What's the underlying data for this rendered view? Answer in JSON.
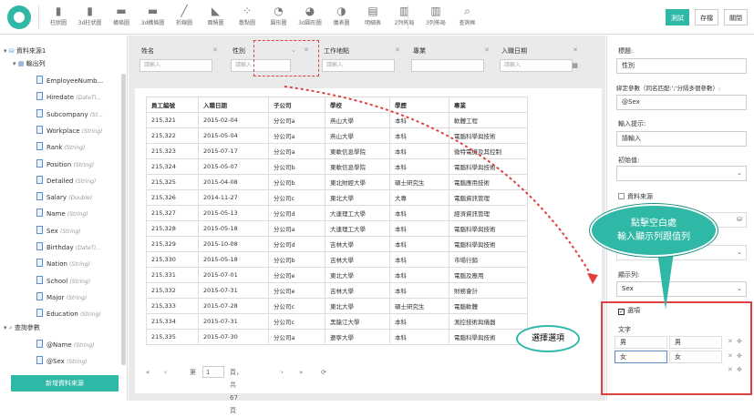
{
  "toolbar": {
    "items": [
      {
        "label": "柱狀圖",
        "icon": "bar-chart-icon"
      },
      {
        "label": "3d柱狀圖",
        "icon": "bar3d-chart-icon"
      },
      {
        "label": "橫條圖",
        "icon": "hbar-chart-icon"
      },
      {
        "label": "3d橫條圖",
        "icon": "hbar3d-chart-icon"
      },
      {
        "label": "折線圖",
        "icon": "line-chart-icon"
      },
      {
        "label": "面積圖",
        "icon": "area-chart-icon"
      },
      {
        "label": "散點圖",
        "icon": "scatter-chart-icon"
      },
      {
        "label": "圓形圖",
        "icon": "pie-chart-icon"
      },
      {
        "label": "3d圓形圖",
        "icon": "pie3d-chart-icon"
      },
      {
        "label": "儀表圖",
        "icon": "gauge-chart-icon"
      },
      {
        "label": "明細表",
        "icon": "detail-table-icon"
      },
      {
        "label": "2列佈局",
        "icon": "two-column-layout-icon"
      },
      {
        "label": "3列佈局",
        "icon": "three-column-layout-icon"
      },
      {
        "label": "查詢框",
        "icon": "query-box-icon"
      }
    ],
    "test_label": "測試",
    "save_label": "存檔",
    "close_label": "關閉"
  },
  "sidebar": {
    "datasource": "資料來源1",
    "output_columns": "輸出列",
    "fields": [
      {
        "name": "EmployeeNumb...",
        "type": ""
      },
      {
        "name": "Hiredate",
        "type": "(DateTi..."
      },
      {
        "name": "Subcompany",
        "type": "(St..."
      },
      {
        "name": "Workplace",
        "type": "(String)"
      },
      {
        "name": "Rank",
        "type": "(String)"
      },
      {
        "name": "Position",
        "type": "(String)"
      },
      {
        "name": "Detailed",
        "type": "(String)"
      },
      {
        "name": "Salary",
        "type": "(Double)"
      },
      {
        "name": "Name",
        "type": "(String)"
      },
      {
        "name": "Sex",
        "type": "(String)"
      },
      {
        "name": "Birthday",
        "type": "(DateTi..."
      },
      {
        "name": "Nation",
        "type": "(String)"
      },
      {
        "name": "School",
        "type": "(String)"
      },
      {
        "name": "Major",
        "type": "(String)"
      },
      {
        "name": "Education",
        "type": "(String)"
      }
    ],
    "query_params": "查詢參數",
    "params": [
      {
        "name": "@Name",
        "type": "(String)"
      },
      {
        "name": "@Sex",
        "type": "(String)"
      }
    ],
    "add_source": "新增資料來源"
  },
  "filters": [
    {
      "label": "姓名",
      "placeholder": "請輸入"
    },
    {
      "label": "性別",
      "placeholder": "請輸入"
    },
    {
      "label": "工作地點",
      "placeholder": "請輸入"
    },
    {
      "label": "專業",
      "placeholder": ""
    },
    {
      "label": "入職日期",
      "placeholder": "請輸入"
    }
  ],
  "table": {
    "headers": [
      "員工編號",
      "入職日期",
      "子公司",
      "學校",
      "學歷",
      "專業"
    ],
    "rows": [
      [
        "215,321",
        "2015-02-04",
        "分公司a",
        "燕山大學",
        "本科",
        "軟體工程"
      ],
      [
        "215,322",
        "2015-05-04",
        "分公司a",
        "燕山大學",
        "本科",
        "電腦科學與技術"
      ],
      [
        "215,323",
        "2015-07-17",
        "分公司a",
        "東軟信息學院",
        "本科",
        "微特電機及其控制"
      ],
      [
        "215,324",
        "2015-05-07",
        "分公司b",
        "東軟信息學院",
        "本科",
        "電腦科學與技術"
      ],
      [
        "215,325",
        "2015-04-08",
        "分公司b",
        "東北財經大學",
        "碩士研究生",
        "電腦應用技術"
      ],
      [
        "215,326",
        "2014-11-27",
        "分公司c",
        "東北大學",
        "大專",
        "電腦資訊管理"
      ],
      [
        "215,327",
        "2015-05-13",
        "分公司d",
        "大連理工大學",
        "本科",
        "經濟資訊管理"
      ],
      [
        "215,328",
        "2015-05-18",
        "分公司a",
        "大連理工大學",
        "本科",
        "電腦科學與技術"
      ],
      [
        "215,329",
        "2015-10-08",
        "分公司d",
        "吉林大學",
        "本科",
        "電腦科學與技術"
      ],
      [
        "215,330",
        "2015-05-18",
        "分公司b",
        "吉林大學",
        "本科",
        "市場行銷"
      ],
      [
        "215,331",
        "2015-07-01",
        "分公司e",
        "東北大學",
        "本科",
        "電腦及應用"
      ],
      [
        "215,332",
        "2015-07-31",
        "分公司e",
        "吉林大學",
        "本科",
        "財務會計"
      ],
      [
        "215,333",
        "2015-07-28",
        "分公司c",
        "東北大學",
        "碩士研究生",
        "電腦軟體"
      ],
      [
        "215,334",
        "2015-07-31",
        "分公司c",
        "黑龍江大學",
        "本科",
        "測控技術與儀器"
      ],
      [
        "215,335",
        "2015-07-30",
        "分公司a",
        "遼寧大學",
        "本科",
        "電腦科學與技術"
      ]
    ]
  },
  "pager": {
    "first": "«",
    "prev": "‹",
    "page_prefix": "第",
    "page_value": "1",
    "page_suffix": "頁，共67頁",
    "next": "›",
    "last": "»"
  },
  "rpanel": {
    "title_label": "標題:",
    "title_value": "性別",
    "bind_label": "綁定參數（同名匹配:';'分隔多個參數）:",
    "bind_value": "@Sex",
    "hint_label": "輸入提示:",
    "hint_value": "請輸入",
    "init_label": "初始值:",
    "init_value": "",
    "datasource_check": "資料來源",
    "display_label": "顯示列:",
    "display_value": "Sex",
    "options_check": "選項",
    "text_label": "文字",
    "options": [
      {
        "text": "男",
        "value": "男"
      },
      {
        "text": "女",
        "value": "女"
      }
    ]
  },
  "annotations": {
    "callout_line1": "點擊空白處",
    "callout_line2": "輸入顯示列跟值列",
    "callout2": "選擇選項"
  },
  "colors": {
    "accent": "#2fb8a6",
    "highlight": "#e04040"
  }
}
